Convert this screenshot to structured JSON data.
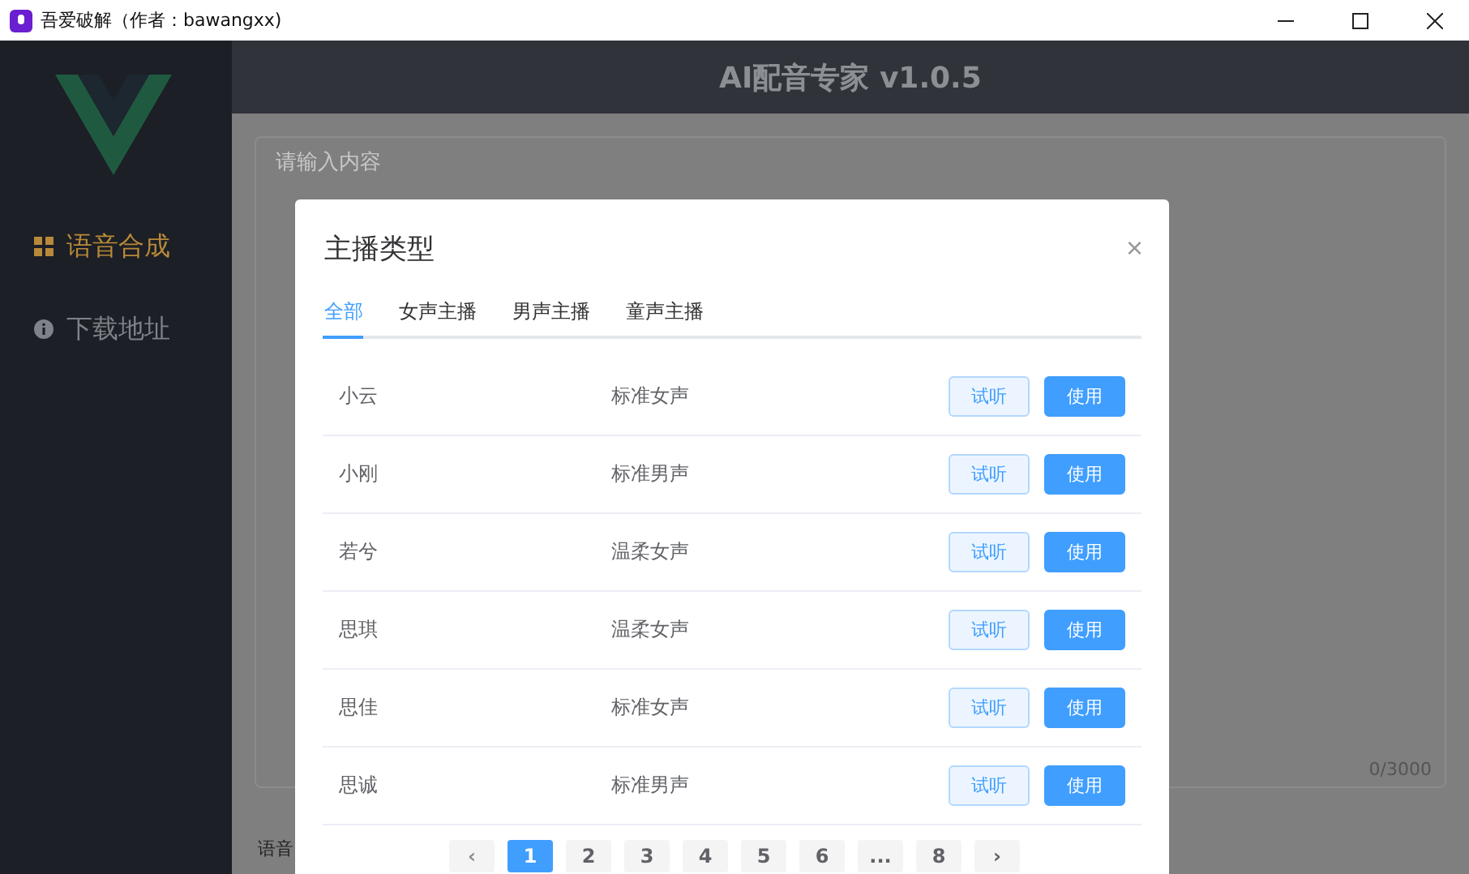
{
  "window": {
    "title": "吾爱破解（作者：bawangxx)"
  },
  "sidebar": {
    "items": [
      {
        "label": "语音合成",
        "selected": true,
        "kind": "grid"
      },
      {
        "label": "下载地址",
        "selected": false,
        "kind": "info"
      }
    ]
  },
  "header": {
    "title": "AI配音专家 v1.0.5"
  },
  "editor": {
    "placeholder": "请输入内容",
    "counter": "0/3000"
  },
  "section_label": "语音",
  "dialog": {
    "title": "主播类型",
    "close": "×",
    "tabs": [
      {
        "label": "全部",
        "selected": true
      },
      {
        "label": "女声主播",
        "selected": false
      },
      {
        "label": "男声主播",
        "selected": false
      },
      {
        "label": "童声主播",
        "selected": false
      }
    ],
    "rows": [
      {
        "name": "小云",
        "type": "标准女声",
        "preview": "试听",
        "use": "使用"
      },
      {
        "name": "小刚",
        "type": "标准男声",
        "preview": "试听",
        "use": "使用"
      },
      {
        "name": "若兮",
        "type": "温柔女声",
        "preview": "试听",
        "use": "使用"
      },
      {
        "name": "思琪",
        "type": "温柔女声",
        "preview": "试听",
        "use": "使用"
      },
      {
        "name": "思佳",
        "type": "标准女声",
        "preview": "试听",
        "use": "使用"
      },
      {
        "name": "思诚",
        "type": "标准男声",
        "preview": "试听",
        "use": "使用"
      }
    ],
    "pagination": {
      "prev": "‹",
      "next": "›",
      "pages": [
        {
          "label": "1",
          "selected": true
        },
        {
          "label": "2",
          "selected": false
        },
        {
          "label": "3",
          "selected": false
        },
        {
          "label": "4",
          "selected": false
        },
        {
          "label": "5",
          "selected": false
        },
        {
          "label": "6",
          "selected": false
        },
        {
          "label": "...",
          "selected": false
        },
        {
          "label": "8",
          "selected": false
        }
      ]
    }
  }
}
